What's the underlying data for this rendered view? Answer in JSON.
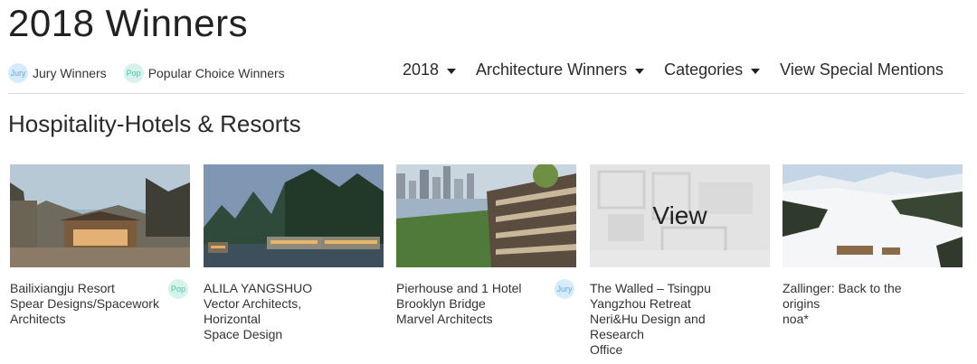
{
  "page": {
    "title": "2018 Winners",
    "section": "Hospitality-Hotels & Resorts"
  },
  "legend": {
    "jury_badge": "Jury",
    "jury_label": "Jury Winners",
    "pop_badge": "Pop",
    "pop_label": "Popular Choice Winners"
  },
  "nav": {
    "year": "2018",
    "architecture": "Architecture Winners",
    "categories": "Categories",
    "special": "View Special Mentions"
  },
  "cards": [
    {
      "line1": "Bailixiangju Resort",
      "line2": "Spear Designs/Spacework",
      "line3": "Architects",
      "badge": "Pop"
    },
    {
      "line1": "ALILA YANGSHUO",
      "line2": "Vector Architects, Horizontal",
      "line3": "Space Design"
    },
    {
      "line1": "Pierhouse and 1 Hotel",
      "line2": "Brooklyn Bridge",
      "line3": "Marvel Architects",
      "badge": "Jury"
    },
    {
      "line1": "The Walled – Tsingpu",
      "line2": "Yangzhou Retreat",
      "line3": "Neri&Hu Design and Research",
      "line4": "Office",
      "overlay": "View"
    },
    {
      "line1": "Zallinger: Back to the origins",
      "line2": "noa*"
    }
  ],
  "colors": {
    "jury_badge_bg": "#d6ebfb",
    "pop_badge_bg": "#d5f3ec",
    "divider": "#dcdcdc"
  }
}
